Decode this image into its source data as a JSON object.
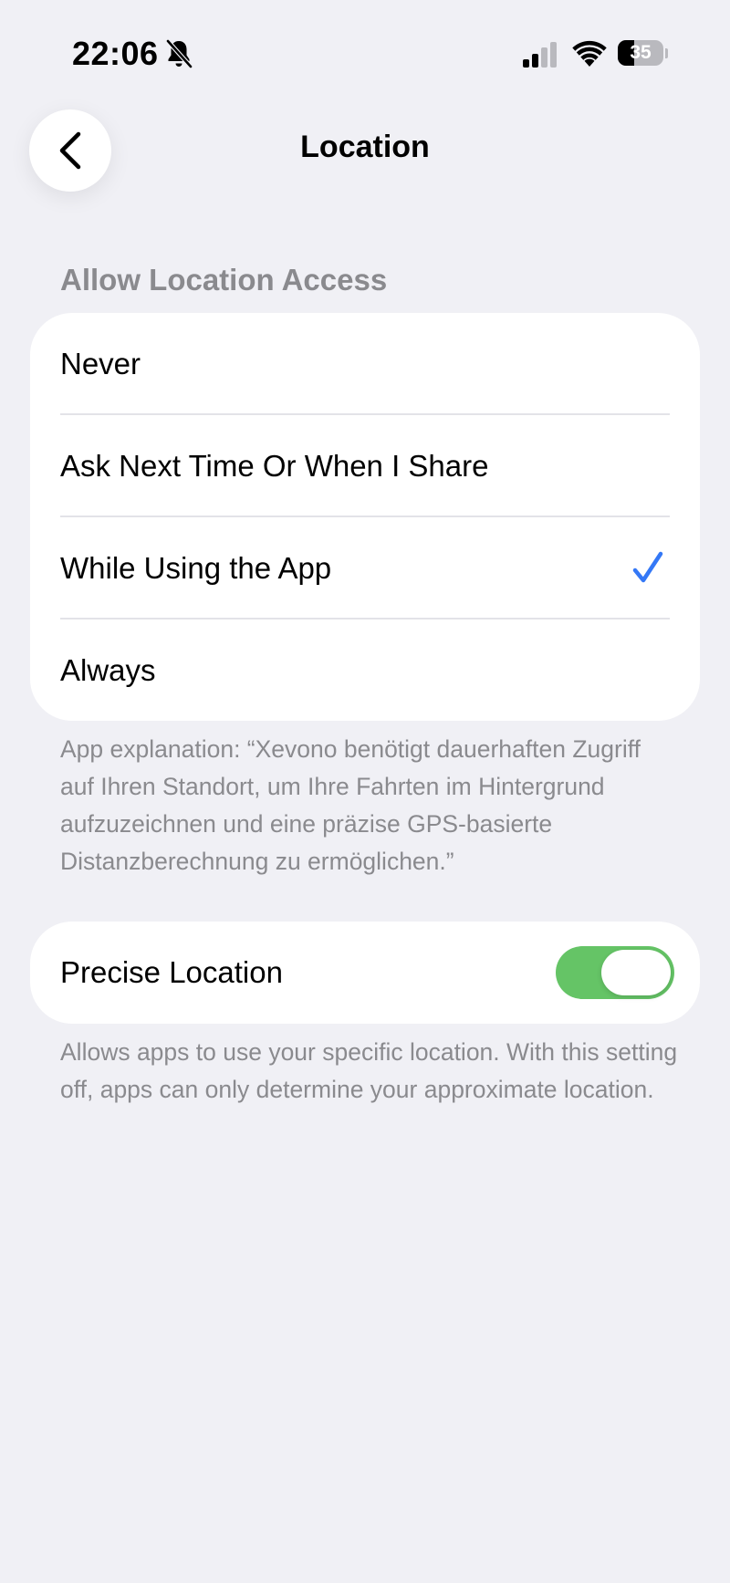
{
  "status_bar": {
    "time": "22:06",
    "battery_level": "35",
    "icons": [
      "bell-slash-icon",
      "cellular-signal-icon",
      "wifi-icon",
      "battery-icon"
    ]
  },
  "nav": {
    "title": "Location",
    "back_icon": "chevron-left-icon"
  },
  "access_section": {
    "header": "Allow Location Access",
    "options": [
      {
        "label": "Never",
        "selected": false
      },
      {
        "label": "Ask Next Time Or When I Share",
        "selected": false
      },
      {
        "label": "While Using the App",
        "selected": true
      },
      {
        "label": "Always",
        "selected": false
      }
    ],
    "explanation": "App explanation: “Xevono benötigt dauerhaften Zugriff auf Ihren Standort, um Ihre Fahrten im Hintergrund aufzuzeichnen und eine präzise GPS-basierte Distanzberechnung zu ermöglichen.”"
  },
  "precise_section": {
    "label": "Precise Location",
    "toggle_on": true,
    "note": "Allows apps to use your specific location. With this setting off, apps can only determine your approximate location."
  },
  "colors": {
    "background": "#F0F0F5",
    "accent_check": "#3478F6",
    "toggle_on": "#65C466",
    "secondary_text": "#8A8A8E"
  }
}
